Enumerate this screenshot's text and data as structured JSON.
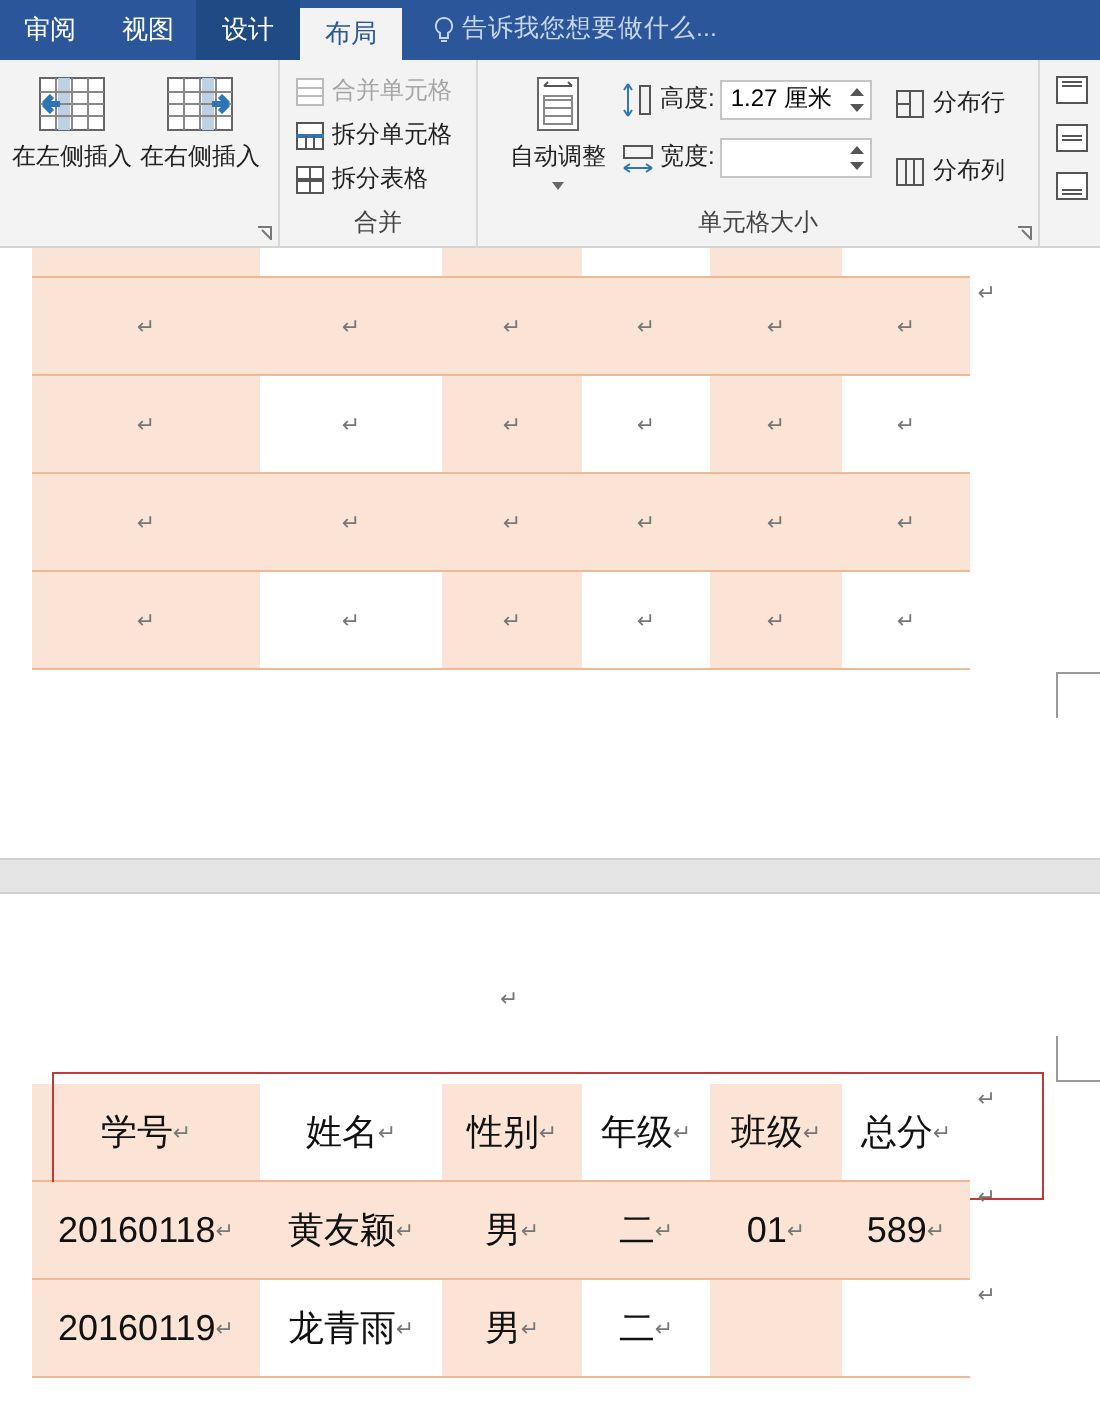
{
  "ribbon": {
    "tabs": [
      {
        "label": "审阅",
        "selected": false,
        "kind": "plain"
      },
      {
        "label": "视图",
        "selected": false,
        "kind": "plain"
      },
      {
        "label": "设计",
        "selected": false,
        "kind": "context"
      },
      {
        "label": "布局",
        "selected": true,
        "kind": "context"
      }
    ],
    "tell_me": {
      "placeholder": "告诉我您想要做什么..."
    },
    "insert_buttons": [
      {
        "label": "在左侧插入",
        "kind": "left"
      },
      {
        "label": "在右侧插入",
        "kind": "right"
      }
    ],
    "merge_group": {
      "title": "合并",
      "items": [
        {
          "label": "合并单元格",
          "disabled": true,
          "kind": "merge"
        },
        {
          "label": "拆分单元格",
          "disabled": false,
          "kind": "split-cells"
        },
        {
          "label": "拆分表格",
          "disabled": false,
          "kind": "split-table"
        }
      ]
    },
    "size_group": {
      "title": "单元格大小",
      "autofit": "自动调整",
      "height_label": "高度:",
      "height_value": "1.27 厘米",
      "width_label": "宽度:",
      "distribute_rows": "分布行",
      "distribute_columns": "分布列"
    }
  },
  "page_one_table": {
    "rows": [
      {
        "kind": "partial",
        "banded": false,
        "cells": [
          {},
          {},
          {},
          {},
          {},
          {}
        ]
      },
      {
        "kind": "full",
        "banded": true,
        "cells": [
          {
            "mark": "↵"
          },
          {
            "mark": "↵"
          },
          {
            "mark": "↵"
          },
          {
            "mark": "↵"
          },
          {
            "mark": "↵"
          },
          {
            "mark": "↵"
          }
        ],
        "row_mark": "↵"
      },
      {
        "kind": "full",
        "banded": false,
        "cells": [
          {
            "mark": "↵"
          },
          {
            "mark": "↵"
          },
          {
            "mark": "↵"
          },
          {
            "mark": "↵"
          },
          {
            "mark": "↵"
          },
          {
            "mark": "↵"
          }
        ]
      },
      {
        "kind": "full",
        "banded": true,
        "cells": [
          {
            "mark": "↵"
          },
          {
            "mark": "↵"
          },
          {
            "mark": "↵"
          },
          {
            "mark": "↵"
          },
          {
            "mark": "↵"
          },
          {
            "mark": "↵"
          }
        ]
      },
      {
        "kind": "full",
        "banded": false,
        "cells": [
          {
            "mark": "↵"
          },
          {
            "mark": "↵"
          },
          {
            "mark": "↵"
          },
          {
            "mark": "↵"
          },
          {
            "mark": "↵"
          },
          {
            "mark": "↵"
          }
        ]
      }
    ]
  },
  "page_two": {
    "paragraph_mark": "↵",
    "table": {
      "rows": [
        {
          "kind": "full",
          "banded": false,
          "highlighted": true,
          "row_mark": "↵",
          "cells": [
            {
              "text": "学号",
              "mark": "↵"
            },
            {
              "text": "姓名",
              "mark": "↵"
            },
            {
              "text": "性别",
              "mark": "↵"
            },
            {
              "text": "年级",
              "mark": "↵"
            },
            {
              "text": "班级",
              "mark": "↵"
            },
            {
              "text": "总分",
              "mark": "↵"
            }
          ]
        },
        {
          "kind": "full",
          "banded": true,
          "highlighted": false,
          "row_mark": "↵",
          "cells": [
            {
              "text": "20160118",
              "mark": "↵"
            },
            {
              "text": "黄友颖",
              "mark": "↵"
            },
            {
              "text": "男",
              "mark": "↵"
            },
            {
              "text": "二",
              "mark": "↵"
            },
            {
              "text": "01",
              "mark": "↵"
            },
            {
              "text": "589",
              "mark": "↵"
            }
          ]
        },
        {
          "kind": "full",
          "banded": false,
          "highlighted": false,
          "row_mark": "↵",
          "cells": [
            {
              "text": "20160119",
              "mark": "↵"
            },
            {
              "text": "龙青雨",
              "mark": "↵"
            },
            {
              "text": "男",
              "mark": "↵"
            },
            {
              "text": "二",
              "mark": "↵"
            },
            {},
            {}
          ]
        }
      ]
    }
  }
}
